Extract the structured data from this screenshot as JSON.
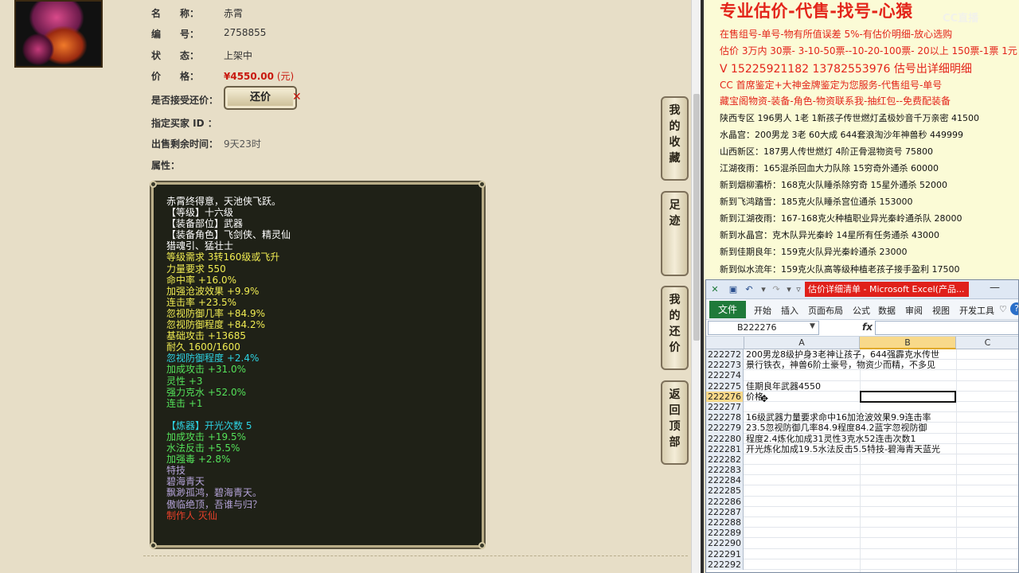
{
  "item": {
    "name_label": "名　　称：",
    "name": "赤霄",
    "id_label": "编　　号：",
    "id": "2758855",
    "status_label": "状　　态：",
    "status": "上架中",
    "price_label": "价　　格：",
    "price": "¥4550.00",
    "price_unit": "(元)",
    "counter_label": "是否接受还价：",
    "counter_button": "还价",
    "counter_close": "✕",
    "buyer_label": "指定买家 ID ：",
    "remain_label": "出售剩余时间：",
    "remain": "9天23时",
    "attr_label": "属性："
  },
  "tooltip": [
    {
      "text": "赤霄终得意，天池侠飞跃。",
      "color": "w"
    },
    {
      "text": "【等级】十六级",
      "color": "w"
    },
    {
      "text": "【装备部位】武器",
      "color": "w"
    },
    {
      "text": "【装备角色】飞剑侠、精灵仙",
      "color": "w"
    },
    {
      "text": "猎魂引、猛壮士",
      "color": "w"
    },
    {
      "text": "等级需求 3转160级或飞升",
      "color": "y"
    },
    {
      "text": "力量要求 550",
      "color": "y"
    },
    {
      "text": "命中率 +16.0%",
      "color": "y"
    },
    {
      "text": "加强沧波效果 +9.9%",
      "color": "y"
    },
    {
      "text": "连击率 +23.5%",
      "color": "y"
    },
    {
      "text": "忽视防御几率 +84.9%",
      "color": "y"
    },
    {
      "text": "忽视防御程度 +84.2%",
      "color": "y"
    },
    {
      "text": "基础攻击 +13685",
      "color": "y"
    },
    {
      "text": "耐久 1600/1600",
      "color": "y"
    },
    {
      "text": "忽视防御程度 +2.4%",
      "color": "c"
    },
    {
      "text": "加成攻击 +31.0%",
      "color": "g"
    },
    {
      "text": "灵性 +3",
      "color": "g"
    },
    {
      "text": "强力克水 +52.0%",
      "color": "g"
    },
    {
      "text": "连击 +1",
      "color": "g"
    },
    {
      "text": "",
      "color": "w"
    },
    {
      "text": "【炼器】开光次数 5",
      "color": "c"
    },
    {
      "text": "加成攻击 +19.5%",
      "color": "g"
    },
    {
      "text": "水法反击 +5.5%",
      "color": "g"
    },
    {
      "text": "加强毒 +2.8%",
      "color": "g"
    },
    {
      "text": "特技",
      "color": "p"
    },
    {
      "text": "碧海青天",
      "color": "p"
    },
    {
      "text": "飘渺孤鸿，碧海青天。",
      "color": "p"
    },
    {
      "text": "傲临绝顶，吾谁与归？",
      "color": "p"
    },
    {
      "text": "制作人 灭仙",
      "color": "r"
    }
  ],
  "side_buttons": [
    {
      "label": "我的收藏"
    },
    {
      "label": "足迹"
    },
    {
      "label": "我的还价"
    },
    {
      "label": "返回顶部"
    }
  ],
  "ad": {
    "title": "专业估价-代售-找号-心猿",
    "logo": "CC直播",
    "lines": [
      {
        "text": "在售组号-单号-物有所值误差 5%-有估价明细-放心选购",
        "style": "red"
      },
      {
        "text": "估价 3万内 30票- 3-10-50票--10-20-100票- 20以上 150票-1票 1元",
        "style": "red"
      },
      {
        "text": "V 15225921182    13782553976   估号出详细明细",
        "style": "phone"
      },
      {
        "text": "CC 首席鉴定+大神金牌鉴定为您服务-代售组号-单号",
        "style": "red"
      },
      {
        "text": "藏宝阁物资-装备-角色-物资联系我-抽红包--免费配装备",
        "style": "red"
      },
      {
        "text": "陕西专区 196男人 1老 1新孩子传世燃灯孟极妙音千万亲密 41500",
        "style": "black"
      },
      {
        "text": "水晶宫：200男龙 3老 60大成 644套浪淘沙年神兽秒 449999",
        "style": "black"
      },
      {
        "text": "山西新区：187男人传世燃灯 4阶正骨混物资号 75800",
        "style": "black"
      },
      {
        "text": "江湖夜雨：165混杀回血大力队除 15穷奇外通杀 60000",
        "style": "black"
      },
      {
        "text": "新到烟柳灞桥：168克火队睡杀除穷奇 15星外通杀 52000",
        "style": "black"
      },
      {
        "text": "新到飞鸿踏雪：185克火队睡杀宫位通杀 153000",
        "style": "black"
      },
      {
        "text": "新到江湖夜雨：167-168克火种植职业异光秦岭通杀队 28000",
        "style": "black"
      },
      {
        "text": "新到水晶宫：克木队异光秦岭 14星所有任务通杀 43000",
        "style": "black"
      },
      {
        "text": "新到佳期良年：159克火队异光秦岭通杀 23000",
        "style": "black"
      },
      {
        "text": "新到似水流年：159克火队高等级种植老孩子接手盈利 17500",
        "style": "black"
      }
    ]
  },
  "excel": {
    "caption": "估价详细清单 - Microsoft Excel(产品...",
    "file_tab": "文件",
    "tabs": [
      "开始",
      "插入",
      "页面布局",
      "公式",
      "数据",
      "审阅",
      "视图",
      "开发工具"
    ],
    "name_box": "B222276",
    "fx": "fx",
    "col_a": "A",
    "col_b": "B",
    "col_c": "C",
    "rows": [
      {
        "n": "222272",
        "text": "200男龙8级护身3老神让孩子，644强霹克水传世"
      },
      {
        "n": "222273",
        "text": "景行铁衣，神兽6阶土豪号，物资少而精，不多见"
      },
      {
        "n": "222274",
        "text": ""
      },
      {
        "n": "222275",
        "text": "佳期良年武器4550"
      },
      {
        "n": "222276",
        "text": "价格"
      },
      {
        "n": "222277",
        "text": ""
      },
      {
        "n": "222278",
        "text": "16级武器力量要求命中16加沧波效果9.9连击率"
      },
      {
        "n": "222279",
        "text": "23.5忽视防御几率84.9程度84.2蓝字忽视防御"
      },
      {
        "n": "222280",
        "text": "程度2.4炼化加成31灵性3克水52连击次数1"
      },
      {
        "n": "222281",
        "text": "开光炼化加成19.5水法反击5.5特技-碧海青天蓝光"
      },
      {
        "n": "222282",
        "text": ""
      },
      {
        "n": "222283",
        "text": ""
      },
      {
        "n": "222284",
        "text": ""
      },
      {
        "n": "222285",
        "text": ""
      },
      {
        "n": "222286",
        "text": ""
      },
      {
        "n": "222287",
        "text": ""
      },
      {
        "n": "222288",
        "text": ""
      },
      {
        "n": "222289",
        "text": ""
      },
      {
        "n": "222290",
        "text": ""
      },
      {
        "n": "222291",
        "text": ""
      },
      {
        "n": "222292",
        "text": ""
      }
    ],
    "selected_row": "222276"
  },
  "colors": {
    "price_red": "#c8180e",
    "ad_red": "#e3241a",
    "excel_green": "#1f7a3a",
    "tooltip_bg": "#1f2117"
  }
}
